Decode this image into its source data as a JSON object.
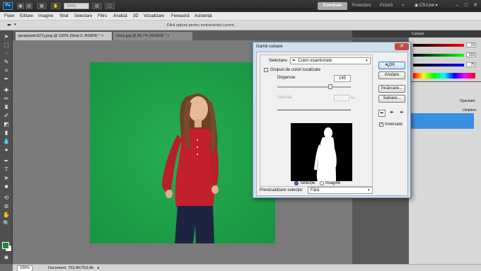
{
  "app": {
    "logo": "Ps",
    "zoom": "100%",
    "workspaces": [
      "Esențiale",
      "Proiectare",
      "Pictură"
    ],
    "more": "»",
    "cs_live": "CS Live",
    "win_controls": [
      "–",
      "□",
      "✕"
    ]
  },
  "menu": [
    "Fișier",
    "Editare",
    "Imagine",
    "Strat",
    "Selectare",
    "Filtru",
    "Analiză",
    "3D",
    "Vizualizare",
    "Fereastră",
    "Asistență"
  ],
  "options_bar": {
    "hint": "Fără opțiuni pentru instrumentul curent."
  },
  "tabs": [
    {
      "label": "janaplastic527y.png @ 100% (Strat 0, RGB/8) *",
      "close": "×"
    },
    {
      "label": "Dock.jpg @ 66,7% (RGB/8) *",
      "close": "×"
    }
  ],
  "status": {
    "zoom": "100%",
    "doc": "Document: 753,4K/753,4K"
  },
  "color_panel": {
    "values": [
      "19",
      "159",
      "75"
    ],
    "tab": "Culoare"
  },
  "layers_panel": {
    "opacity_label": "Opacitate:",
    "fill_label": "Umplere:"
  },
  "dialog": {
    "title": "Gamă culoare",
    "close": "✕",
    "select_label": "Selectare:",
    "select_value": "Culori eșantionate",
    "localized_label": "Grupuri de culori localizate",
    "fuzziness_label": "Dispersie:",
    "fuzziness_value": "145",
    "range_label": "Interval:",
    "range_unit": "%",
    "radio_selection": "Selecție",
    "radio_image": "Imagine",
    "preview_label": "Previzualizare selecție:",
    "preview_value": "Fără",
    "buttons": {
      "ok": "OK",
      "cancel": "Anulare",
      "load": "Încărcare...",
      "save": "Salvare..."
    },
    "invert_label": "Inversare",
    "fuzziness_fraction": 0.72
  }
}
